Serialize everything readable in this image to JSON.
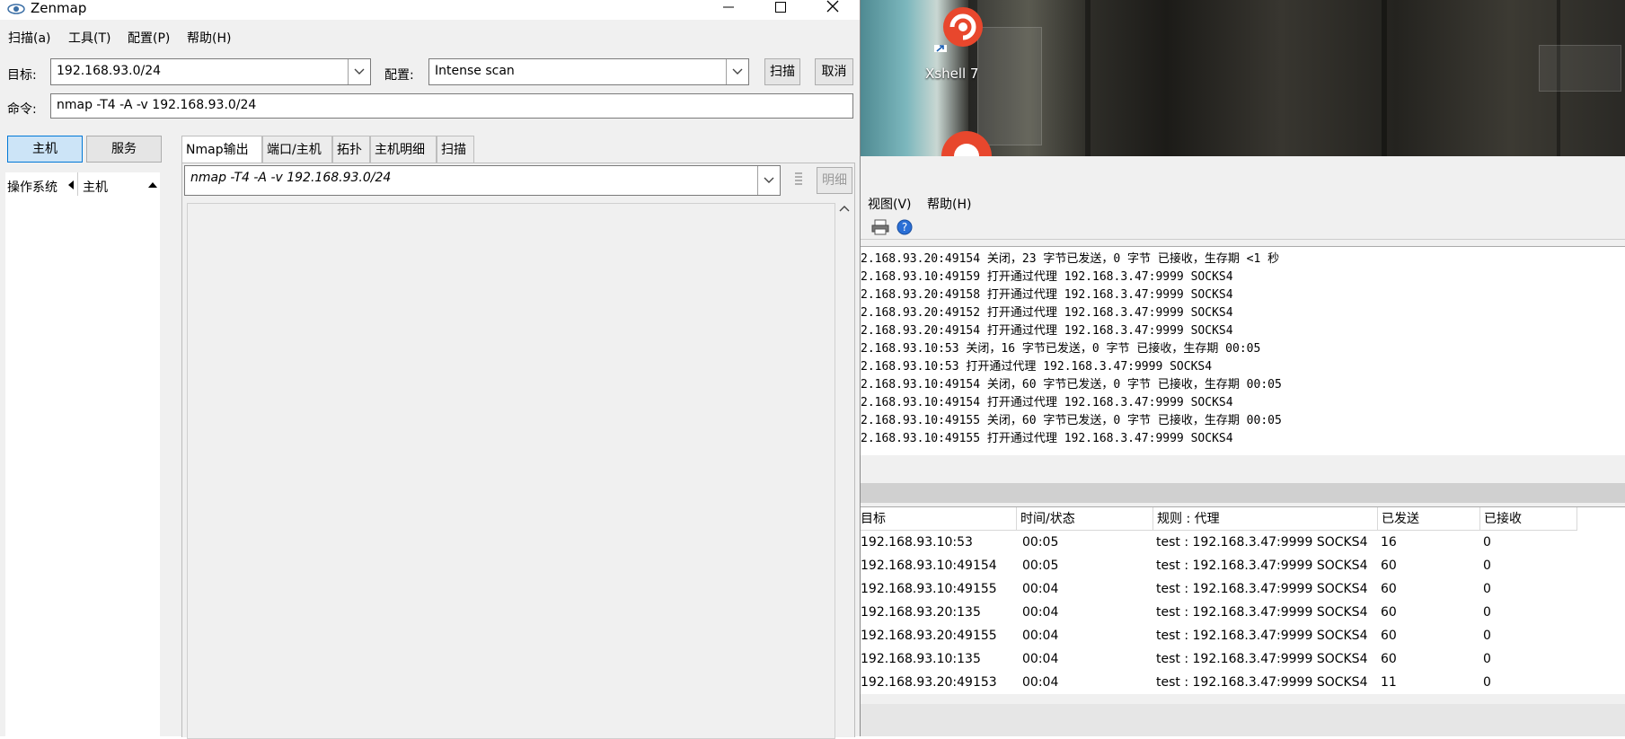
{
  "window": {
    "title": "Zenmap"
  },
  "menu": {
    "scan": "扫描(a)",
    "tools": "工具(T)",
    "profile": "配置(P)",
    "help": "帮助(H)"
  },
  "target": {
    "label": "目标:",
    "value": "192.168.93.0/24"
  },
  "profile": {
    "label": "配置:",
    "value": "Intense scan"
  },
  "buttons": {
    "scan": "扫描",
    "cancel": "取消"
  },
  "command": {
    "label": "命令:",
    "value": "nmap -T4 -A -v 192.168.93.0/24"
  },
  "view_toggle": {
    "hosts": "主机",
    "services": "服务"
  },
  "host_list": {
    "os_header": "操作系统",
    "host_header": "主机"
  },
  "tabs": [
    "Nmap输出",
    "端口/主机",
    "拓扑",
    "主机明细",
    "扫描"
  ],
  "output": {
    "command_select": "nmap -T4 -A -v 192.168.93.0/24",
    "details_button": "明细"
  },
  "desktop": {
    "shortcut_label": "Xshell 7"
  },
  "proxy_app": {
    "menu": {
      "view": "视图(V)",
      "help": "帮助(H)"
    },
    "log_lines": [
      "2.168.93.20:49154 关闭，23 字节已发送，0 字节 已接收，生存期 <1 秒",
      "2.168.93.10:49159 打开通过代理 192.168.3.47:9999 SOCKS4",
      "2.168.93.20:49158 打开通过代理 192.168.3.47:9999 SOCKS4",
      "2.168.93.20:49152 打开通过代理 192.168.3.47:9999 SOCKS4",
      "2.168.93.20:49154 打开通过代理 192.168.3.47:9999 SOCKS4",
      "2.168.93.10:53 关闭，16 字节已发送，0 字节 已接收，生存期 00:05",
      "2.168.93.10:53 打开通过代理 192.168.3.47:9999 SOCKS4",
      "2.168.93.10:49154 关闭，60 字节已发送，0 字节 已接收，生存期 00:05",
      "2.168.93.10:49154 打开通过代理 192.168.3.47:9999 SOCKS4",
      "2.168.93.10:49155 关闭，60 字节已发送，0 字节 已接收，生存期 00:05",
      "2.168.93.10:49155 打开通过代理 192.168.3.47:9999 SOCKS4"
    ],
    "table": {
      "headers": [
        "目标",
        "时间/状态",
        "规则 : 代理",
        "已发送",
        "已接收"
      ],
      "rows": [
        [
          "192.168.93.10:53",
          "00:05",
          "test : 192.168.3.47:9999 SOCKS4",
          "16",
          "0"
        ],
        [
          "192.168.93.10:49154",
          "00:05",
          "test : 192.168.3.47:9999 SOCKS4",
          "60",
          "0"
        ],
        [
          "192.168.93.10:49155",
          "00:04",
          "test : 192.168.3.47:9999 SOCKS4",
          "60",
          "0"
        ],
        [
          "192.168.93.20:135",
          "00:04",
          "test : 192.168.3.47:9999 SOCKS4",
          "60",
          "0"
        ],
        [
          "192.168.93.20:49155",
          "00:04",
          "test : 192.168.3.47:9999 SOCKS4",
          "60",
          "0"
        ],
        [
          "192.168.93.10:135",
          "00:04",
          "test : 192.168.3.47:9999 SOCKS4",
          "60",
          "0"
        ],
        [
          "192.168.93.20:49153",
          "00:04",
          "test : 192.168.3.47:9999 SOCKS4",
          "11",
          "0"
        ]
      ]
    }
  }
}
